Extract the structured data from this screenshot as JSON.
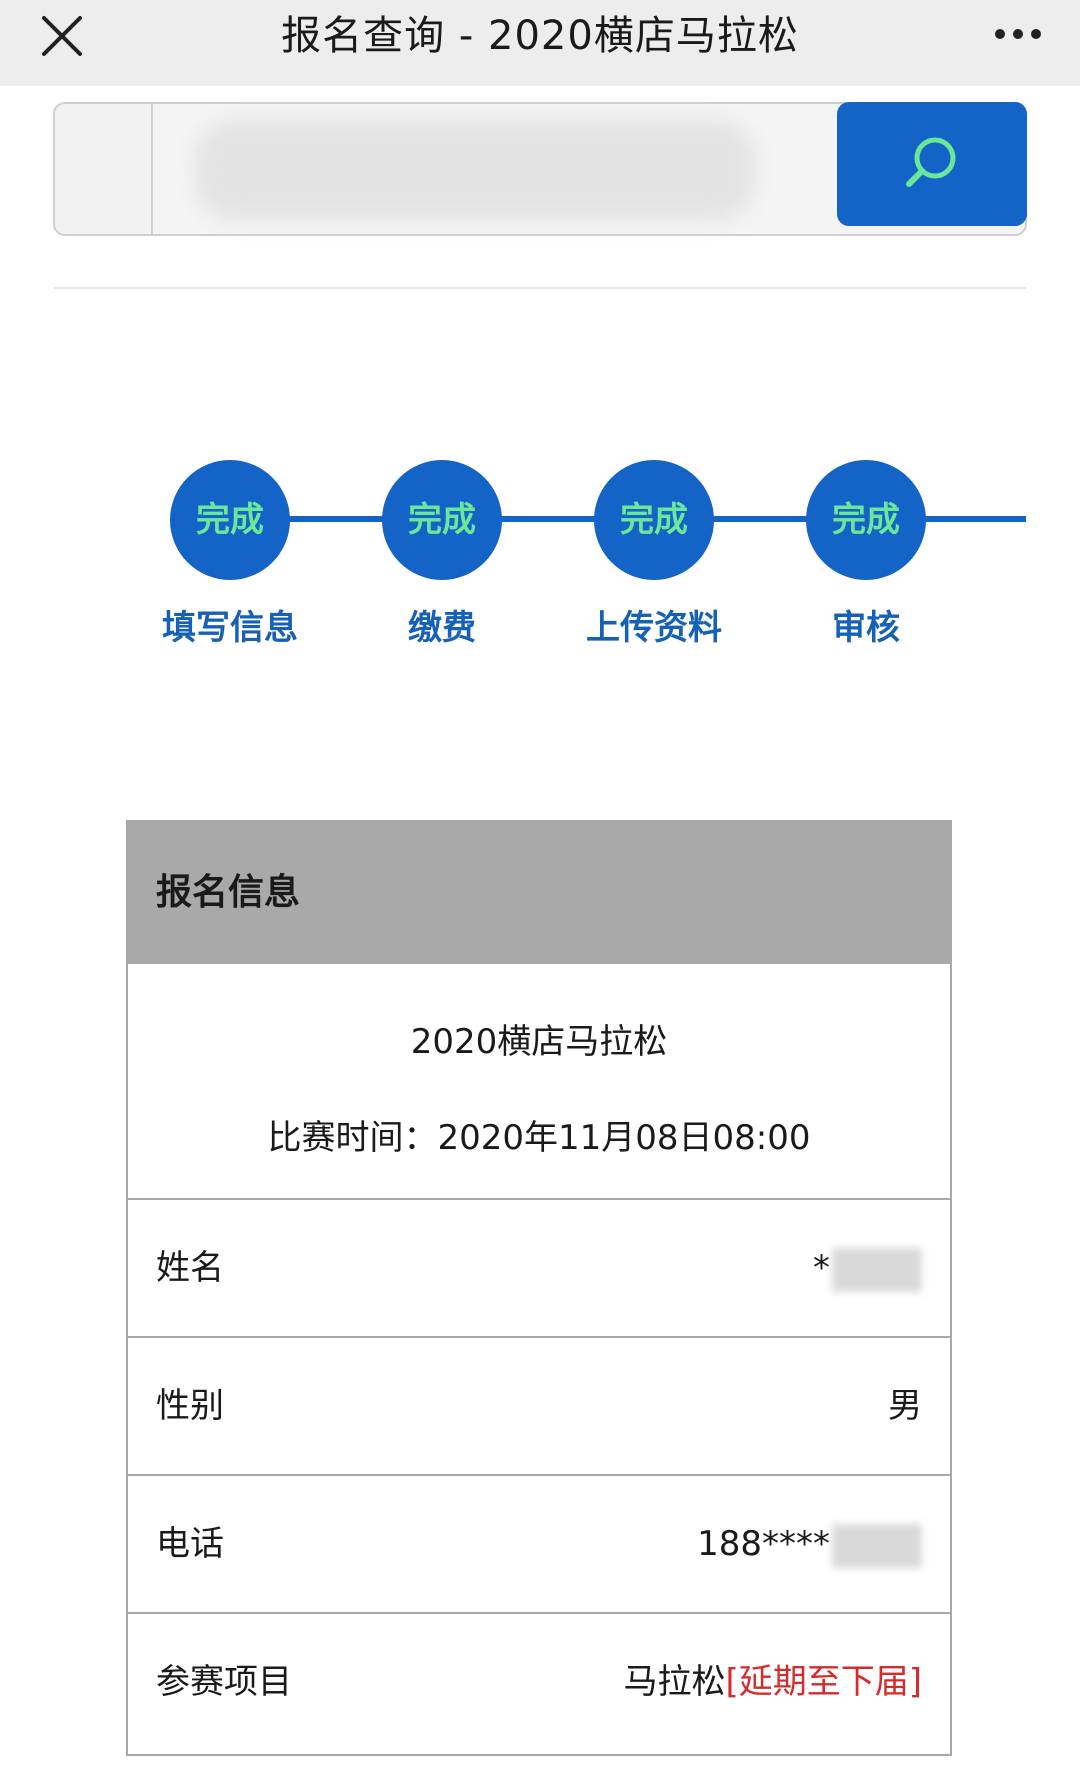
{
  "topbar": {
    "title": "报名查询 - 2020横店马拉松"
  },
  "search": {
    "value": "1",
    "placeholder": ""
  },
  "steps": [
    {
      "status": "完成",
      "label": "填写信息"
    },
    {
      "status": "完成",
      "label": "缴费"
    },
    {
      "status": "完成",
      "label": "上传资料"
    },
    {
      "status": "完成",
      "label": "审核"
    }
  ],
  "info": {
    "header": "报名信息",
    "event_name": "2020横店马拉松",
    "event_time": "比赛时间：2020年11月08日08:00",
    "rows": [
      {
        "label": "姓名",
        "value": "*"
      },
      {
        "label": "性别",
        "value": "男"
      },
      {
        "label": "电话",
        "value": "188****"
      },
      {
        "label": "参赛项目",
        "value": "马拉松",
        "tag": "[延期至下届]"
      }
    ]
  },
  "colors": {
    "primary": "#1463c6",
    "status_text": "#6be79a",
    "step_label": "#1661b8",
    "header_bg": "#a9a9a9",
    "tag": "#d62b2b"
  }
}
